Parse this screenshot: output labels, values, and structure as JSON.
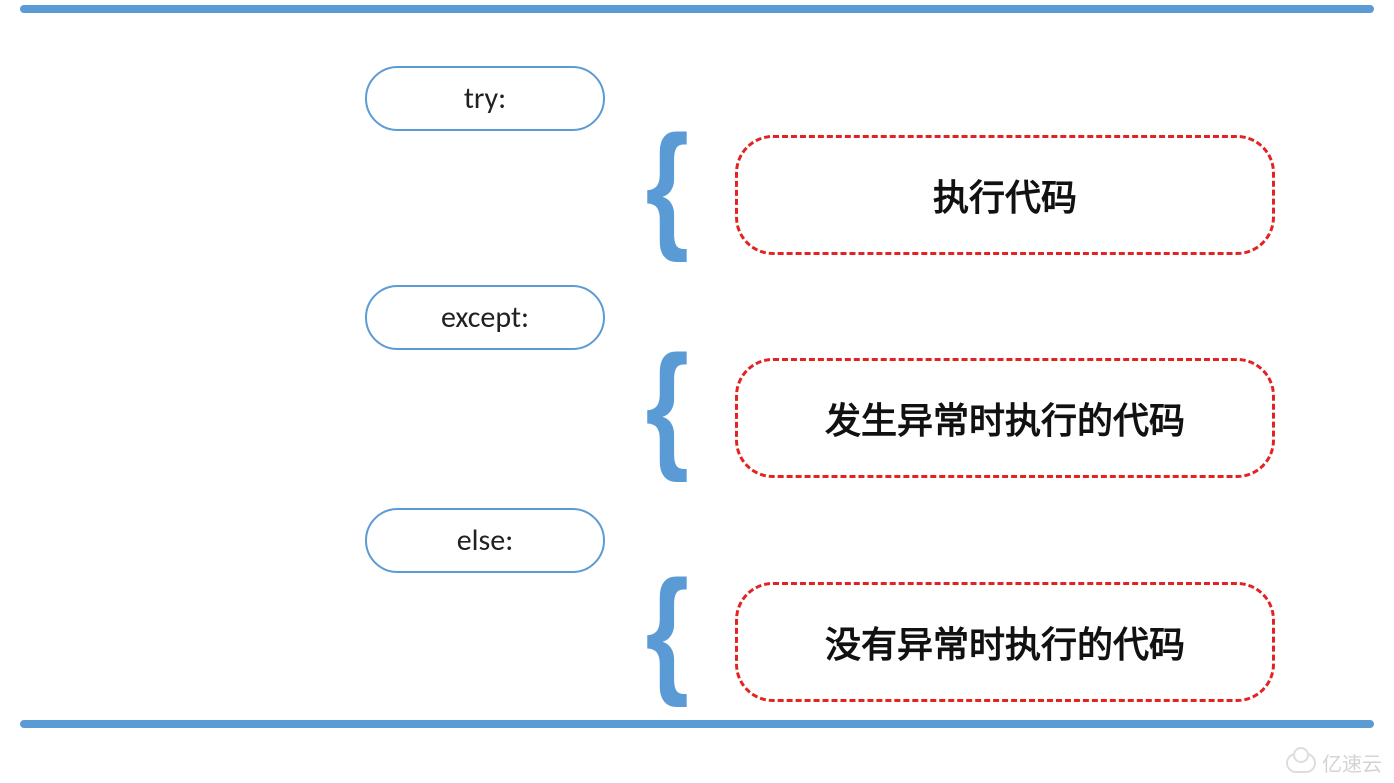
{
  "keywords": {
    "try": "try:",
    "except": "except:",
    "else": "else:"
  },
  "descriptions": {
    "exec": "执行代码",
    "exception": "发生异常时执行的代码",
    "noexception": "没有异常时执行的代码"
  },
  "brace": "{",
  "watermark": "亿速云",
  "colors": {
    "accent_blue": "#5b9bd5",
    "dash_red": "#e32322"
  }
}
